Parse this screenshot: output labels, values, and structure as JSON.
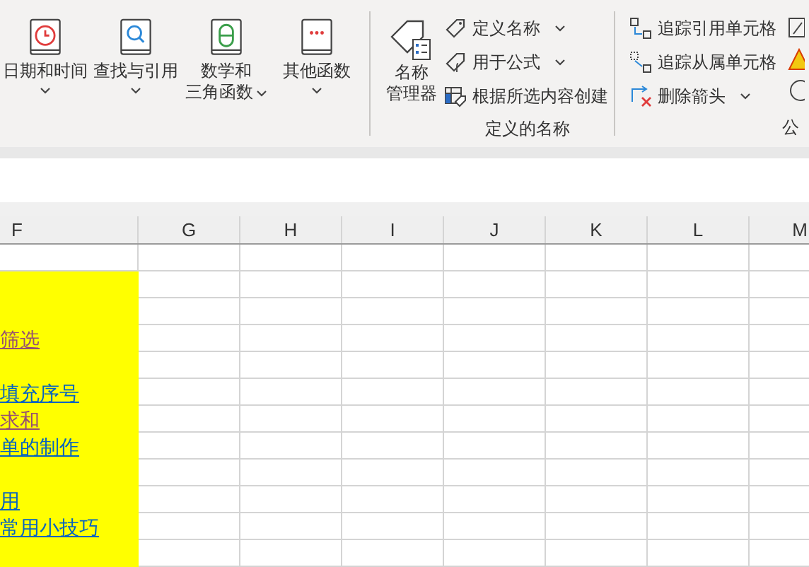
{
  "ribbon": {
    "function_buttons": [
      {
        "kind": "clock",
        "lines": [
          "日期和时间"
        ],
        "dropdown": true
      },
      {
        "kind": "search",
        "lines": [
          "查找与引用"
        ],
        "dropdown": true
      },
      {
        "kind": "theta",
        "lines": [
          "数学和",
          "三角函数"
        ],
        "dropdown": true
      },
      {
        "kind": "more",
        "lines": [
          "其他函数"
        ],
        "dropdown": true
      }
    ],
    "names_group": {
      "big_button": {
        "lines": [
          "名称",
          "管理器"
        ]
      },
      "small_buttons": [
        {
          "kind": "tag",
          "label": "定义名称",
          "dropdown": true
        },
        {
          "kind": "tag-fx",
          "label": "用于公式",
          "dropdown": true
        },
        {
          "kind": "grid-tag",
          "label": "根据所选内容创建",
          "dropdown": false
        }
      ],
      "label": "定义的名称"
    },
    "audit_group": {
      "small_buttons": [
        {
          "kind": "trace-precedents",
          "label": "追踪引用单元格",
          "dropdown": false
        },
        {
          "kind": "trace-dependents",
          "label": "追踪从属单元格",
          "dropdown": false
        },
        {
          "kind": "remove-arrows",
          "label": "删除箭头",
          "dropdown": true
        }
      ],
      "label": "公"
    }
  },
  "sheet": {
    "columns": [
      "F",
      "G",
      "H",
      "I",
      "J",
      "K",
      "L",
      "M"
    ],
    "rows": [
      {
        "highlighted": false
      },
      {
        "highlighted": true
      },
      {
        "highlighted": true
      },
      {
        "highlighted": true,
        "link": {
          "text": "筛选",
          "visited": true
        }
      },
      {
        "highlighted": true
      },
      {
        "highlighted": true,
        "link": {
          "text": "填充序号",
          "visited": false
        }
      },
      {
        "highlighted": true,
        "link": {
          "text": "求和",
          "visited": true
        }
      },
      {
        "highlighted": true,
        "link": {
          "text": "单的制作",
          "visited": false
        }
      },
      {
        "highlighted": true
      },
      {
        "highlighted": true,
        "link": {
          "text": "用",
          "visited": false
        }
      },
      {
        "highlighted": true,
        "link": {
          "text": "常用小技巧",
          "visited": false
        }
      },
      {
        "highlighted": true
      }
    ]
  }
}
